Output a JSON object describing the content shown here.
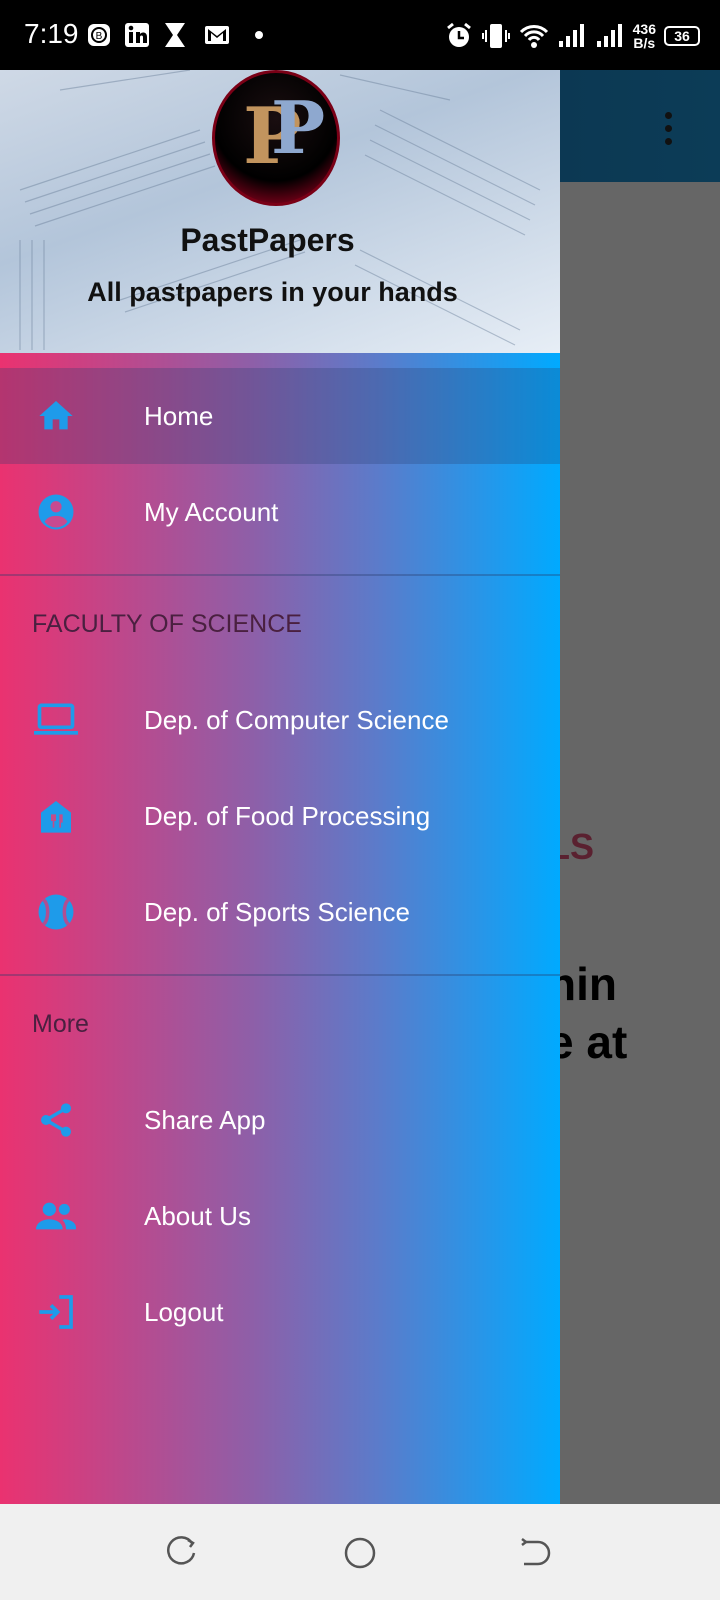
{
  "status_bar": {
    "time": "7:19",
    "net_speed_value": "436",
    "net_speed_unit": "B/s",
    "battery": "36"
  },
  "header": {
    "title": "PastPapers",
    "subtitle": "All pastpapers in your hands"
  },
  "menu": {
    "home": "Home",
    "account": "My Account",
    "section_science": "FACULTY OF SCIENCE",
    "computer_science": "Dep. of Computer Science",
    "food_processing": "Dep. of Food Processing",
    "sports_science": "Dep. of Sports Science",
    "section_more": "More",
    "share": "Share App",
    "about": "About Us",
    "logout": "Logout"
  },
  "background": {
    "fragment_1": "LS",
    "fragment_2a": "hin",
    "fragment_2b": "e at"
  },
  "colors": {
    "accent_icon": "#1e9bea",
    "drawer_gradient_start": "#ea3270",
    "drawer_gradient_end": "#00aaff"
  }
}
